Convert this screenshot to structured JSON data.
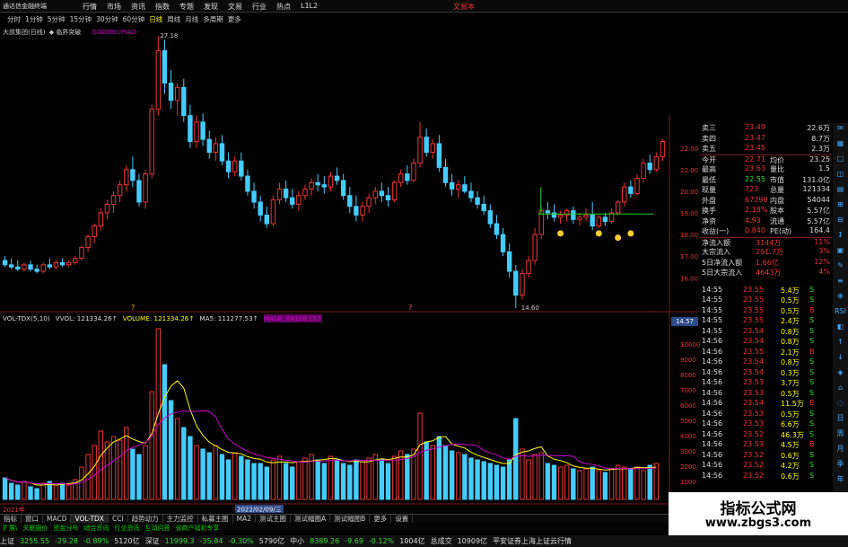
{
  "app": {
    "title": "通达信金融终端",
    "right_label": "文易本",
    "menu": [
      "行情",
      "市场",
      "资讯",
      "指数",
      "专题",
      "发现",
      "文易",
      "行业",
      "热点",
      "L1L2"
    ]
  },
  "periods": {
    "items": [
      "分时",
      "1分钟",
      "5分钟",
      "15分钟",
      "30分钟",
      "60分钟",
      "日线",
      "周线",
      "月线",
      "多周期",
      "更多"
    ],
    "active": "日线"
  },
  "main_chart": {
    "info_text": "大叔集团(日线)",
    "formula": "◆ 临界突破",
    "indicator_tag": "GOODGUPIAO-",
    "high_label": "27.18",
    "low_label": "14.60",
    "last_price_tag": "14.57",
    "y_ticks": [
      "22.00",
      "21.00",
      "20.00",
      "19.00",
      "18.00",
      "17.00",
      "16.00"
    ],
    "marker_left": "?",
    "marker_right": "?"
  },
  "chart_data": {
    "type": "candlestick",
    "y_range": [
      14.6,
      27.18
    ],
    "up_color": "#e33",
    "down_color": "#4cf",
    "ohlc": [
      [
        16.8,
        17.0,
        16.5,
        16.6
      ],
      [
        16.6,
        16.9,
        16.4,
        16.5
      ],
      [
        16.5,
        16.8,
        16.3,
        16.4
      ],
      [
        16.4,
        16.7,
        16.3,
        16.6
      ],
      [
        16.6,
        16.8,
        16.3,
        16.4
      ],
      [
        16.4,
        16.6,
        16.2,
        16.3
      ],
      [
        16.3,
        16.7,
        16.2,
        16.6
      ],
      [
        16.6,
        16.9,
        16.4,
        16.5
      ],
      [
        16.5,
        16.8,
        16.4,
        16.7
      ],
      [
        16.7,
        16.9,
        16.5,
        16.6
      ],
      [
        16.6,
        16.8,
        16.5,
        16.7
      ],
      [
        16.7,
        17.0,
        16.6,
        16.9
      ],
      [
        16.9,
        17.5,
        16.8,
        17.4
      ],
      [
        17.4,
        18.0,
        17.2,
        17.9
      ],
      [
        17.9,
        18.5,
        17.6,
        18.4
      ],
      [
        18.4,
        19.2,
        18.2,
        19.0
      ],
      [
        19.0,
        19.6,
        18.7,
        19.4
      ],
      [
        19.4,
        20.0,
        19.0,
        19.8
      ],
      [
        19.8,
        20.5,
        19.5,
        20.3
      ],
      [
        20.3,
        21.2,
        20.0,
        21.0
      ],
      [
        21.0,
        21.6,
        20.2,
        20.5
      ],
      [
        20.5,
        20.8,
        19.3,
        19.5
      ],
      [
        19.5,
        21.0,
        19.2,
        20.8
      ],
      [
        20.8,
        24.0,
        20.6,
        23.8
      ],
      [
        23.8,
        27.18,
        23.5,
        26.5
      ],
      [
        26.5,
        27.0,
        24.5,
        25.0
      ],
      [
        25.0,
        25.6,
        23.8,
        24.2
      ],
      [
        24.2,
        25.0,
        23.5,
        24.8
      ],
      [
        24.8,
        25.2,
        23.2,
        23.5
      ],
      [
        23.5,
        24.0,
        22.0,
        22.3
      ],
      [
        22.3,
        23.5,
        22.0,
        23.2
      ],
      [
        23.2,
        23.6,
        22.1,
        22.4
      ],
      [
        22.4,
        22.8,
        21.5,
        21.8
      ],
      [
        21.8,
        22.5,
        21.4,
        22.2
      ],
      [
        22.2,
        22.6,
        21.2,
        21.4
      ],
      [
        21.4,
        21.8,
        20.6,
        20.9
      ],
      [
        20.9,
        21.6,
        20.7,
        21.4
      ],
      [
        21.4,
        21.8,
        20.5,
        20.7
      ],
      [
        20.7,
        21.0,
        19.8,
        20.0
      ],
      [
        20.0,
        20.4,
        19.2,
        19.5
      ],
      [
        19.5,
        19.8,
        18.6,
        18.9
      ],
      [
        18.9,
        19.3,
        18.3,
        18.5
      ],
      [
        18.5,
        19.8,
        18.4,
        19.6
      ],
      [
        19.6,
        20.4,
        19.4,
        20.1
      ],
      [
        20.1,
        20.5,
        19.5,
        19.7
      ],
      [
        19.7,
        20.1,
        19.2,
        19.4
      ],
      [
        19.4,
        20.0,
        19.1,
        19.8
      ],
      [
        19.8,
        20.3,
        19.6,
        20.1
      ],
      [
        20.1,
        20.6,
        19.8,
        20.4
      ],
      [
        20.4,
        20.8,
        20.0,
        20.3
      ],
      [
        20.3,
        20.7,
        19.9,
        20.2
      ],
      [
        20.2,
        20.9,
        20.0,
        20.7
      ],
      [
        20.7,
        21.1,
        20.3,
        20.5
      ],
      [
        20.5,
        20.8,
        19.6,
        19.8
      ],
      [
        19.8,
        20.2,
        19.0,
        19.3
      ],
      [
        19.3,
        19.8,
        18.6,
        18.9
      ],
      [
        18.9,
        19.5,
        18.6,
        19.3
      ],
      [
        19.3,
        19.9,
        19.0,
        19.7
      ],
      [
        19.7,
        20.2,
        19.4,
        20.0
      ],
      [
        20.0,
        20.4,
        19.5,
        19.8
      ],
      [
        19.8,
        20.2,
        19.3,
        19.6
      ],
      [
        19.6,
        20.5,
        19.5,
        20.4
      ],
      [
        20.4,
        21.0,
        20.2,
        20.8
      ],
      [
        20.8,
        21.2,
        20.3,
        20.5
      ],
      [
        20.5,
        21.5,
        20.4,
        21.3
      ],
      [
        21.3,
        23.2,
        21.1,
        22.5
      ],
      [
        22.5,
        22.9,
        21.6,
        21.8
      ],
      [
        21.8,
        22.4,
        21.5,
        22.2
      ],
      [
        22.2,
        22.6,
        20.9,
        21.1
      ],
      [
        21.1,
        21.5,
        20.2,
        20.4
      ],
      [
        20.4,
        20.8,
        19.8,
        20.1
      ],
      [
        20.1,
        20.5,
        19.7,
        20.3
      ],
      [
        20.3,
        20.7,
        19.9,
        20.0
      ],
      [
        20.0,
        20.4,
        19.5,
        19.7
      ],
      [
        19.7,
        20.0,
        19.2,
        19.4
      ],
      [
        19.4,
        19.8,
        18.9,
        19.1
      ],
      [
        19.1,
        19.4,
        18.3,
        18.5
      ],
      [
        18.5,
        18.9,
        17.8,
        18.0
      ],
      [
        18.0,
        18.3,
        17.0,
        17.2
      ],
      [
        17.2,
        17.6,
        16.0,
        16.3
      ],
      [
        16.3,
        16.6,
        14.6,
        15.2
      ],
      [
        15.2,
        16.4,
        15.0,
        16.2
      ],
      [
        16.2,
        17.0,
        16.0,
        16.8
      ],
      [
        16.8,
        18.3,
        16.6,
        18.0
      ],
      [
        18.0,
        19.3,
        17.8,
        19.1
      ],
      [
        19.1,
        19.5,
        18.7,
        19.0
      ],
      [
        19.0,
        19.4,
        18.6,
        18.8
      ],
      [
        18.8,
        19.1,
        18.5,
        18.9
      ],
      [
        18.9,
        19.2,
        18.6,
        19.1
      ],
      [
        19.1,
        19.3,
        18.5,
        18.7
      ],
      [
        18.7,
        19.0,
        18.4,
        18.8
      ],
      [
        18.8,
        19.2,
        18.6,
        18.9
      ],
      [
        18.9,
        19.5,
        18.2,
        18.4
      ],
      [
        18.4,
        18.9,
        18.3,
        18.8
      ],
      [
        18.8,
        19.0,
        18.4,
        18.6
      ],
      [
        18.6,
        19.2,
        18.5,
        19.0
      ],
      [
        19.0,
        19.6,
        18.9,
        19.5
      ],
      [
        19.5,
        20.4,
        19.3,
        20.2
      ],
      [
        20.2,
        20.5,
        19.7,
        19.9
      ],
      [
        19.9,
        20.8,
        19.8,
        20.6
      ],
      [
        20.6,
        21.5,
        20.4,
        21.3
      ],
      [
        21.3,
        21.7,
        20.8,
        21.0
      ],
      [
        21.0,
        21.8,
        20.9,
        21.6
      ],
      [
        21.6,
        22.4,
        21.4,
        22.3
      ]
    ],
    "volume": [
      12,
      9,
      8,
      10,
      7,
      6,
      9,
      10,
      8,
      9,
      8,
      11,
      18,
      25,
      30,
      38,
      32,
      35,
      33,
      40,
      28,
      25,
      30,
      60,
      95,
      75,
      55,
      45,
      40,
      35,
      30,
      28,
      26,
      30,
      25,
      22,
      26,
      24,
      22,
      20,
      20,
      18,
      22,
      24,
      20,
      18,
      21,
      23,
      25,
      22,
      20,
      24,
      22,
      20,
      19,
      22,
      21,
      23,
      25,
      22,
      20,
      24,
      27,
      25,
      28,
      48,
      32,
      30,
      35,
      30,
      27,
      26,
      25,
      23,
      22,
      21,
      20,
      19,
      18,
      22,
      45,
      28,
      22,
      25,
      26,
      20,
      19,
      18,
      19,
      17,
      16,
      17,
      18,
      16,
      15,
      17,
      19,
      18,
      17,
      18,
      16,
      19,
      20
    ],
    "vol_ma_color": "#c0c",
    "vol_ma2_color": "#ff0"
  },
  "volume_header": {
    "title": "VOL-TDX(5,10)",
    "vvol": "VVOL: 121334.26↑",
    "volume": "VOLUME: 121334.26↑",
    "ma5": "MA5: 111277.53↑",
    "ma10": "MA10: 84116.15↑"
  },
  "vol_y_ticks": [
    "10000",
    "9000",
    "8000",
    "7000",
    "6000",
    "5000",
    "4000",
    "3000",
    "2000",
    "1000"
  ],
  "x_axis": {
    "start": "2021年",
    "cursor": "2022/02/09/三"
  },
  "tabs": [
    "指标",
    "窗口",
    "MACD",
    "VOL-TDX",
    "CCI",
    "趋势动力",
    "主力监控",
    "私募主图",
    "MA2",
    "测试主图",
    "测试幅图A",
    "测试幅图B",
    "更多",
    "设置"
  ],
  "tabs_active": "VOL-TDX",
  "hints": [
    "扩展\\",
    "关联报价",
    "资金分布",
    "综合资讯",
    "行业资讯",
    "互动问答",
    "省商户福利专享"
  ],
  "statusbar": {
    "sh_name": "上证",
    "sh_val": "3255.55",
    "sh_chg": "-29.28",
    "sh_pct": "-0.89%",
    "sh_amt": "5120亿",
    "sz_name": "深证",
    "sz_val": "11999.3",
    "sz_chg": "-35.84",
    "sz_pct": "-0.30%",
    "sz_amt": "5790亿",
    "zx_name": "中小",
    "zx_val": "8389.26",
    "zx_chg": "-9.69",
    "zx_pct": "-0.12%",
    "zx_amt": "1004亿",
    "total_label": "总成交",
    "total_val": "10909亿",
    "msg": "平安证券上海上证云行情"
  },
  "quote_panel": {
    "rows": [
      {
        "l": "卖三",
        "v": "23.49",
        "r": "22.6万"
      },
      {
        "l": "卖四",
        "v": "23.47",
        "r": "8.7万"
      },
      {
        "l": "卖五",
        "v": "23.45",
        "r": "2.3万"
      },
      {
        "l": "今开",
        "v": "22.71",
        "l2": "均价",
        "r": "23.25"
      },
      {
        "l": "最高",
        "v": "23.63",
        "l2": "量比",
        "r": "1.5"
      },
      {
        "l": "最低",
        "v": "22.55",
        "l2": "市值",
        "r": "131.0亿"
      },
      {
        "l": "现量",
        "v": "723",
        "l2": "总量",
        "r": "121334"
      },
      {
        "l": "外盘",
        "v": "67290",
        "l2": "内盘",
        "r": "54044"
      },
      {
        "l": "换手",
        "v": "2.18%",
        "l2": "股本",
        "r": "5.57亿"
      },
      {
        "l": "净资",
        "v": "4.93",
        "l2": "流通",
        "r": "5.57亿"
      },
      {
        "l": "收益(一)",
        "v": "0.840",
        "l2": "PE(动)",
        "r": "164.4"
      },
      {
        "l": "净流入额",
        "v": "3144万",
        "r": "11%"
      },
      {
        "l": "大宗流入",
        "v": "291.7万",
        "r": "3%"
      },
      {
        "l": "5日净流入额",
        "v": "1.66亿",
        "r": "12%"
      },
      {
        "l": "5日大宗流入",
        "v": "4643万",
        "r": "4%"
      }
    ],
    "ticks": [
      {
        "t": "14:55",
        "p": "23.55",
        "v": "5.4万",
        "s": "S"
      },
      {
        "t": "14:55",
        "p": "23.55",
        "v": "0.5万",
        "s": "S"
      },
      {
        "t": "14:55",
        "p": "23.55",
        "v": "0.5万",
        "s": "B"
      },
      {
        "t": "14:55",
        "p": "23.55",
        "v": "2.4万",
        "s": "S"
      },
      {
        "t": "14:55",
        "p": "23.54",
        "v": "0.8万",
        "s": "S"
      },
      {
        "t": "14:56",
        "p": "23.54",
        "v": "0.8万",
        "s": "S"
      },
      {
        "t": "14:56",
        "p": "23.55",
        "v": "2.1万",
        "s": "B"
      },
      {
        "t": "14:56",
        "p": "23.54",
        "v": "0.8万",
        "s": "S"
      },
      {
        "t": "14:56",
        "p": "23.54",
        "v": "0.3万",
        "s": "S"
      },
      {
        "t": "14:56",
        "p": "23.53",
        "v": "3.7万",
        "s": "S"
      },
      {
        "t": "14:56",
        "p": "23.53",
        "v": "0.5万",
        "s": "S"
      },
      {
        "t": "14:56",
        "p": "23.54",
        "v": "11.5万",
        "s": "B"
      },
      {
        "t": "14:56",
        "p": "23.53",
        "v": "0.5万",
        "s": "S"
      },
      {
        "t": "14:56",
        "p": "23.53",
        "v": "6.6万",
        "s": "S"
      },
      {
        "t": "14:56",
        "p": "23.52",
        "v": "46.3万",
        "s": "S"
      },
      {
        "t": "14:56",
        "p": "23.53",
        "v": "4.5万",
        "s": "B"
      },
      {
        "t": "14:56",
        "p": "23.52",
        "v": "0.6万",
        "s": "S"
      },
      {
        "t": "14:56",
        "p": "23.52",
        "v": "4.2万",
        "s": "S"
      },
      {
        "t": "14:56",
        "p": "23.52",
        "v": "0.6万",
        "s": "S"
      }
    ]
  },
  "sidebar_icons": [
    "✉",
    "▦",
    "□",
    "◫",
    "▤",
    "⊞",
    "⊟",
    "↕",
    "▣",
    "✎",
    "≡",
    "⊕",
    "RSI",
    "◧",
    "↑",
    "↓",
    "◈",
    "⌂",
    "◌",
    "日",
    "周",
    "月",
    "季",
    "年",
    "◆",
    "▷"
  ],
  "watermark": {
    "title": "指标公式网",
    "url": "www.zbgs3.com"
  }
}
